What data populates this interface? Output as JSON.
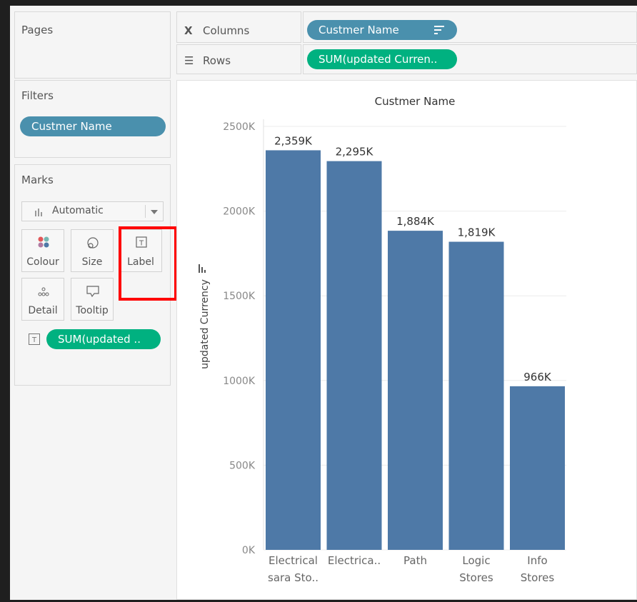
{
  "pages_panel": {
    "title": "Pages"
  },
  "filters_panel": {
    "title": "Filters",
    "pill": "Custmer Name"
  },
  "marks_panel": {
    "title": "Marks",
    "mark_type": "Automatic",
    "buttons": [
      "Colour",
      "Size",
      "Label",
      "Detail",
      "Tooltip"
    ],
    "label_pill": "SUM(updated .."
  },
  "shelves": {
    "columns_label": "Columns",
    "columns_pill": "Custmer Name",
    "rows_label": "Rows",
    "rows_pill": "SUM(updated Curren.."
  },
  "colors": {
    "bar": "#4e79a7",
    "dimension_pill": "#4a90ad",
    "measure_pill": "#00b180",
    "highlight": "#ff0000"
  },
  "chart_data": {
    "type": "bar",
    "title": "Custmer Name",
    "ylabel": "updated Currency",
    "categories": [
      [
        "Electrical",
        "sara Sto.."
      ],
      [
        "Electrica.."
      ],
      [
        "Path"
      ],
      [
        "Logic",
        "Stores"
      ],
      [
        "Info",
        "Stores"
      ]
    ],
    "values": [
      2359,
      2295,
      1884,
      1819,
      966
    ],
    "data_labels": [
      "2,359K",
      "2,295K",
      "1,884K",
      "1,819K",
      "966K"
    ],
    "ylim": [
      0,
      2500
    ],
    "yticks": [
      0,
      500,
      1000,
      1500,
      2000,
      2500
    ],
    "ytick_labels": [
      "0K",
      "500K",
      "1000K",
      "1500K",
      "2000K",
      "2500K"
    ],
    "grid": true
  }
}
